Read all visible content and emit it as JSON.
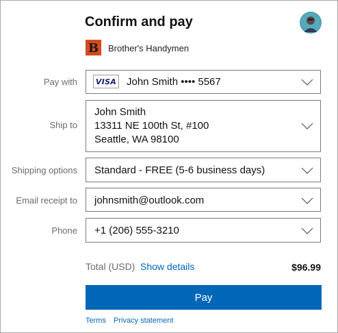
{
  "header": {
    "title": "Confirm and pay",
    "merchant_name": "Brother's Handymen",
    "merchant_logo_letter": "B",
    "merchant_logo_color": "#d54c1c"
  },
  "pay_with": {
    "label": "Pay with",
    "card_brand": "VISA",
    "value": "John Smith •••• 5567"
  },
  "ship_to": {
    "label": "Ship to",
    "name": "John Smith",
    "street": "13311 NE 100th St, #100",
    "city": "Seattle, WA 98100"
  },
  "shipping_options": {
    "label": "Shipping options",
    "value": "Standard - FREE (5-6 business days)"
  },
  "email_receipt": {
    "label": "Email receipt to",
    "value": "johnsmith@outlook.com"
  },
  "phone": {
    "label": "Phone",
    "value": "+1 (206) 555-3210"
  },
  "total": {
    "label": "Total (USD)",
    "details_link": "Show details",
    "amount": "$96.99"
  },
  "actions": {
    "pay_label": "Pay"
  },
  "footer": {
    "terms": "Terms",
    "privacy": "Privacy statement"
  },
  "colors": {
    "accent": "#0067b8",
    "field_border": "#7a7a7a",
    "label_gray": "#6b6b6b"
  },
  "icons": [
    "user-avatar-icon",
    "chevron-down-icon",
    "visa-card-icon",
    "merchant-logo-icon"
  ]
}
